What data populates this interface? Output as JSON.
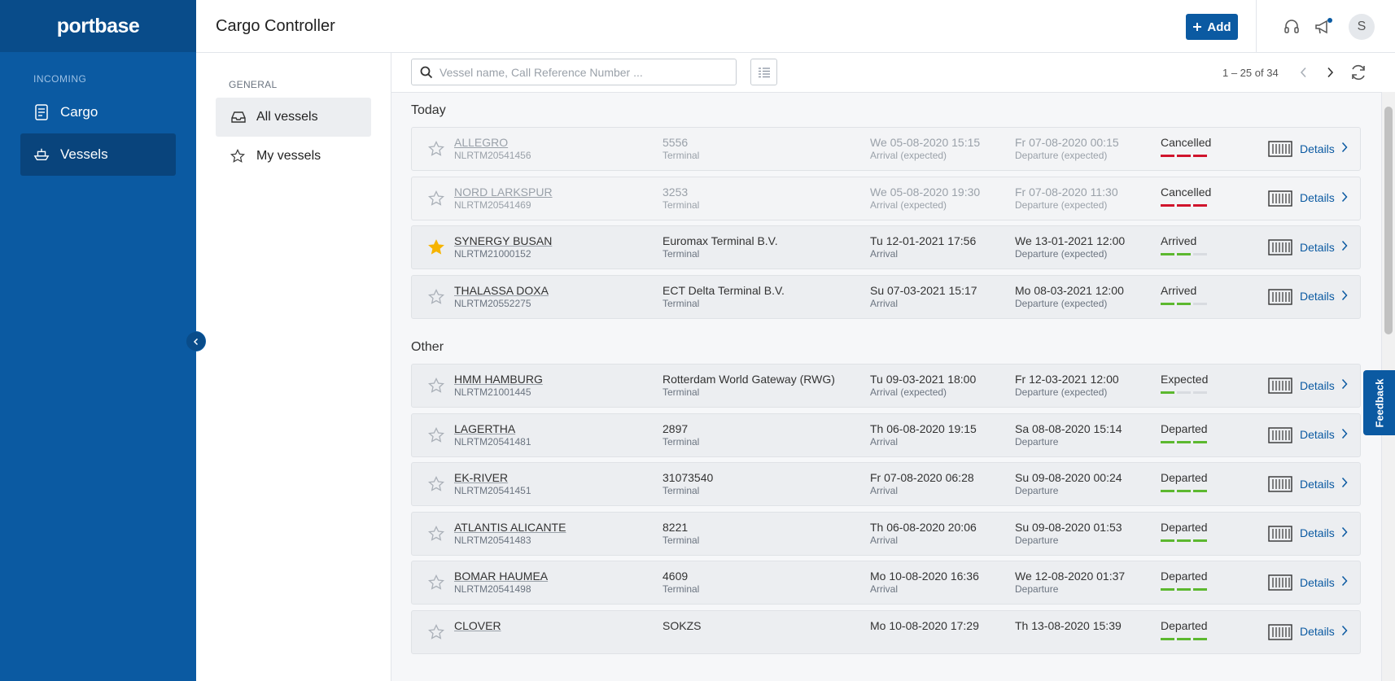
{
  "app": {
    "brand": "portbase",
    "page_title": "Cargo Controller"
  },
  "sidebar": {
    "section": "INCOMING",
    "items": [
      {
        "label": "Cargo",
        "icon": "document-icon",
        "active": false
      },
      {
        "label": "Vessels",
        "icon": "ship-icon",
        "active": true
      }
    ]
  },
  "header": {
    "add_label": "Add",
    "avatar_initial": "S"
  },
  "filters": {
    "section": "GENERAL",
    "items": [
      {
        "label": "All vessels",
        "icon": "inbox-icon",
        "active": true
      },
      {
        "label": "My vessels",
        "icon": "star-outline-icon",
        "active": false
      }
    ]
  },
  "toolbar": {
    "search_placeholder": "Vessel name, Call Reference Number ...",
    "pagination": "1 – 25 of 34"
  },
  "groups": [
    {
      "title": "Today",
      "rows": [
        {
          "name": "ALLEGRO",
          "crn": "NLRTM20541456",
          "terminal": "5556",
          "terminal_label": "Terminal",
          "arrival": "We 05-08-2020 15:15",
          "arrival_label": "Arrival (expected)",
          "departure": "Fr 07-08-2020 00:15",
          "departure_label": "Departure (expected)",
          "status": "Cancelled",
          "favorite": false,
          "details": "Details"
        },
        {
          "name": "NORD LARKSPUR",
          "crn": "NLRTM20541469",
          "terminal": "3253",
          "terminal_label": "Terminal",
          "arrival": "We 05-08-2020 19:30",
          "arrival_label": "Arrival (expected)",
          "departure": "Fr 07-08-2020 11:30",
          "departure_label": "Departure (expected)",
          "status": "Cancelled",
          "favorite": false,
          "details": "Details"
        },
        {
          "name": "SYNERGY BUSAN",
          "crn": "NLRTM21000152",
          "terminal": "Euromax Terminal B.V.",
          "terminal_label": "Terminal",
          "arrival": "Tu 12-01-2021 17:56",
          "arrival_label": "Arrival",
          "departure": "We 13-01-2021 12:00",
          "departure_label": "Departure (expected)",
          "status": "Arrived",
          "favorite": true,
          "details": "Details"
        },
        {
          "name": "THALASSA DOXA",
          "crn": "NLRTM20552275",
          "terminal": "ECT Delta Terminal B.V.",
          "terminal_label": "Terminal",
          "arrival": "Su 07-03-2021 15:17",
          "arrival_label": "Arrival",
          "departure": "Mo 08-03-2021 12:00",
          "departure_label": "Departure (expected)",
          "status": "Arrived",
          "favorite": false,
          "details": "Details"
        }
      ]
    },
    {
      "title": "Other",
      "rows": [
        {
          "name": "HMM HAMBURG",
          "crn": "NLRTM21001445",
          "terminal": "Rotterdam World Gateway (RWG)",
          "terminal_label": "Terminal",
          "arrival": "Tu 09-03-2021 18:00",
          "arrival_label": "Arrival (expected)",
          "departure": "Fr 12-03-2021 12:00",
          "departure_label": "Departure (expected)",
          "status": "Expected",
          "favorite": false,
          "details": "Details"
        },
        {
          "name": "LAGERTHA",
          "crn": "NLRTM20541481",
          "terminal": "2897",
          "terminal_label": "Terminal",
          "arrival": "Th 06-08-2020 19:15",
          "arrival_label": "Arrival",
          "departure": "Sa 08-08-2020 15:14",
          "departure_label": "Departure",
          "status": "Departed",
          "favorite": false,
          "details": "Details"
        },
        {
          "name": "EK-RIVER",
          "crn": "NLRTM20541451",
          "terminal": "31073540",
          "terminal_label": "Terminal",
          "arrival": "Fr 07-08-2020 06:28",
          "arrival_label": "Arrival",
          "departure": "Su 09-08-2020 00:24",
          "departure_label": "Departure",
          "status": "Departed",
          "favorite": false,
          "details": "Details"
        },
        {
          "name": "ATLANTIS ALICANTE",
          "crn": "NLRTM20541483",
          "terminal": "8221",
          "terminal_label": "Terminal",
          "arrival": "Th 06-08-2020 20:06",
          "arrival_label": "Arrival",
          "departure": "Su 09-08-2020 01:53",
          "departure_label": "Departure",
          "status": "Departed",
          "favorite": false,
          "details": "Details"
        },
        {
          "name": "BOMAR HAUMEA",
          "crn": "NLRTM20541498",
          "terminal": "4609",
          "terminal_label": "Terminal",
          "arrival": "Mo 10-08-2020 16:36",
          "arrival_label": "Arrival",
          "departure": "We 12-08-2020 01:37",
          "departure_label": "Departure",
          "status": "Departed",
          "favorite": false,
          "details": "Details"
        },
        {
          "name": "CLOVER",
          "crn": "",
          "terminal": "SOKZS",
          "terminal_label": "",
          "arrival": "Mo 10-08-2020 17:29",
          "arrival_label": "",
          "departure": "Th 13-08-2020 15:39",
          "departure_label": "",
          "status": "Departed",
          "favorite": false,
          "details": "Details"
        }
      ]
    }
  ],
  "status_colors": {
    "Cancelled": {
      "on": "#d0142c",
      "count": 3
    },
    "Arrived": {
      "on": "#5cb82f",
      "count": 2
    },
    "Expected": {
      "on": "#5cb82f",
      "count": 1
    },
    "Departed": {
      "on": "#5cb82f",
      "count": 3
    }
  },
  "feedback_label": "Feedback"
}
